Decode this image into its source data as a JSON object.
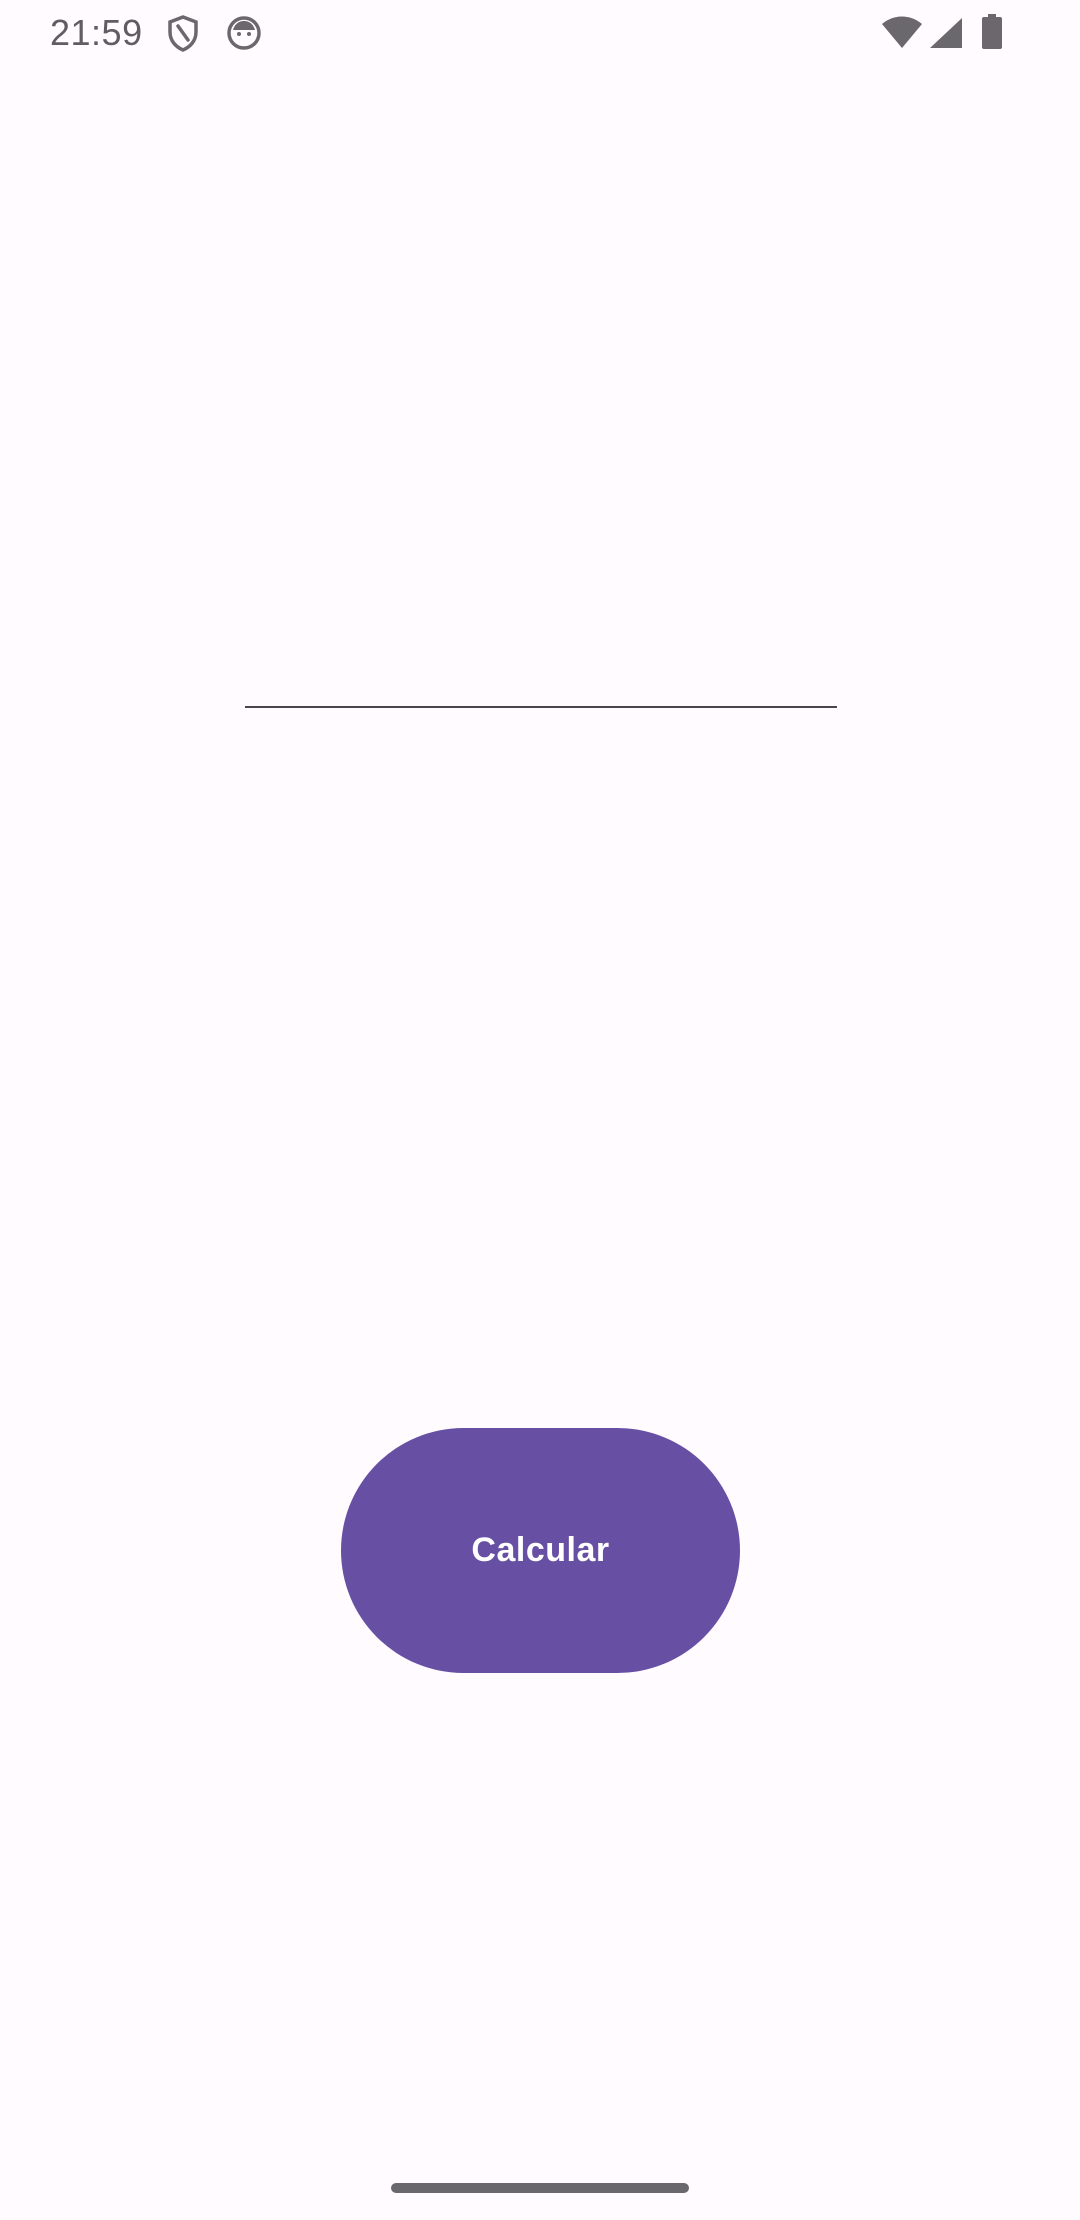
{
  "status_bar": {
    "time": "21:59",
    "icons": [
      "shield-icon",
      "face-icon",
      "wifi-icon",
      "signal-icon",
      "battery-icon"
    ],
    "icon_color": "#6b686d"
  },
  "main": {
    "input": {
      "value": "",
      "placeholder": ""
    },
    "calculate_button": {
      "label": "Calcular",
      "color": "#6750a4",
      "text_color": "#ffffff"
    }
  },
  "theme": {
    "background": "#fffbfe"
  }
}
